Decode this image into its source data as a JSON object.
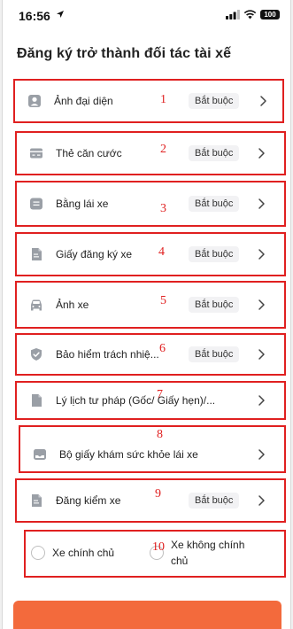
{
  "status_bar": {
    "time": "16:56",
    "battery": "100"
  },
  "page_title": "Đăng ký trở thành đối tác tài xế",
  "items": [
    {
      "label": "Ảnh đại diện",
      "badge": "Bắt buộc",
      "annotation": "1"
    },
    {
      "label": "Thẻ căn cước",
      "badge": "Bắt buộc",
      "annotation": "2"
    },
    {
      "label": "Bằng lái xe",
      "badge": "Bắt buộc",
      "annotation": "3"
    },
    {
      "label": "Giấy đăng ký xe",
      "badge": "Bắt buộc",
      "annotation": "4"
    },
    {
      "label": "Ảnh xe",
      "badge": "Bắt buộc",
      "annotation": "5"
    },
    {
      "label": "Bảo hiểm trách nhiệ...",
      "badge": "Bắt buộc",
      "annotation": "6"
    },
    {
      "label": "Lý lịch tư pháp (Gốc/ Giấy hẹn)/...",
      "annotation": "7"
    },
    {
      "label": "Bộ giấy khám sức khỏe lái xe",
      "annotation": "8"
    },
    {
      "label": "Đăng kiểm xe",
      "badge": "Bắt buộc",
      "annotation": "9"
    }
  ],
  "ownership": {
    "option_owner": "Xe chính chủ",
    "option_not_owner_line1": "Xe không chính",
    "option_not_owner_line2": "chủ",
    "annotation": "10"
  },
  "colors": {
    "annotation_box": "#e02020",
    "accent": "#f36a3c"
  }
}
